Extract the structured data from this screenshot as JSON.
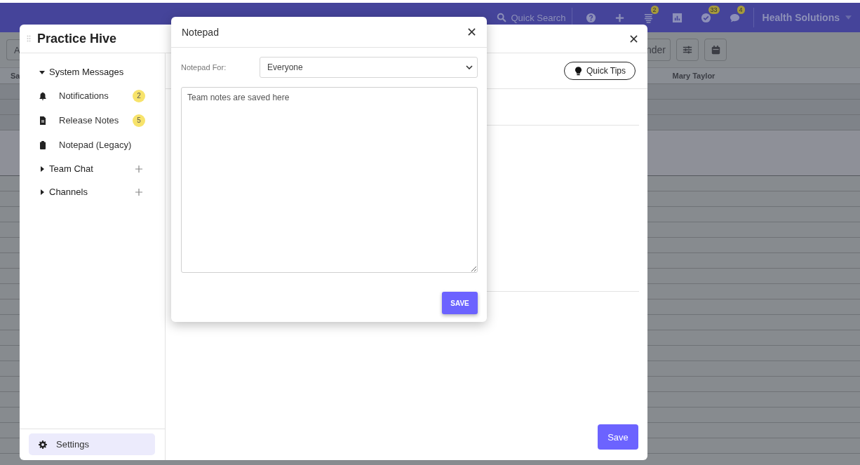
{
  "topbar": {
    "search": {
      "placeholder": "Quick Search"
    },
    "icons": [
      {
        "kind": "help"
      },
      {
        "kind": "plus"
      },
      {
        "kind": "list",
        "badge": "2"
      },
      {
        "kind": "chart"
      },
      {
        "kind": "check",
        "badge": "33"
      },
      {
        "kind": "chat",
        "badge": "4"
      }
    ],
    "account": "Health Solutions"
  },
  "toolbar": {
    "left_button": "A",
    "right_button": "nder"
  },
  "table": {
    "columns": [
      "Sa",
      "Mary Taylor"
    ]
  },
  "panel": {
    "title": "Practice Hive",
    "sidebar": [
      {
        "label": "System Messages",
        "expanded": true,
        "children": [
          {
            "label": "Notifications",
            "kind": "bell",
            "badge": "2"
          },
          {
            "label": "Release Notes",
            "kind": "file",
            "badge": "5"
          },
          {
            "label": "Notepad (Legacy)",
            "kind": "clipboard"
          }
        ]
      },
      {
        "label": "Team Chat",
        "expanded": false,
        "addable": true
      },
      {
        "label": "Channels",
        "expanded": false,
        "addable": true
      }
    ],
    "settings": {
      "label": "Settings",
      "selected": true
    },
    "quick_tips": "Quick Tips",
    "save": "Save"
  },
  "notepad": {
    "title": "Notepad",
    "for_label": "Notepad For:",
    "for_value": "Everyone",
    "placeholder": "Team notes are saved here",
    "save": "SAVE"
  }
}
